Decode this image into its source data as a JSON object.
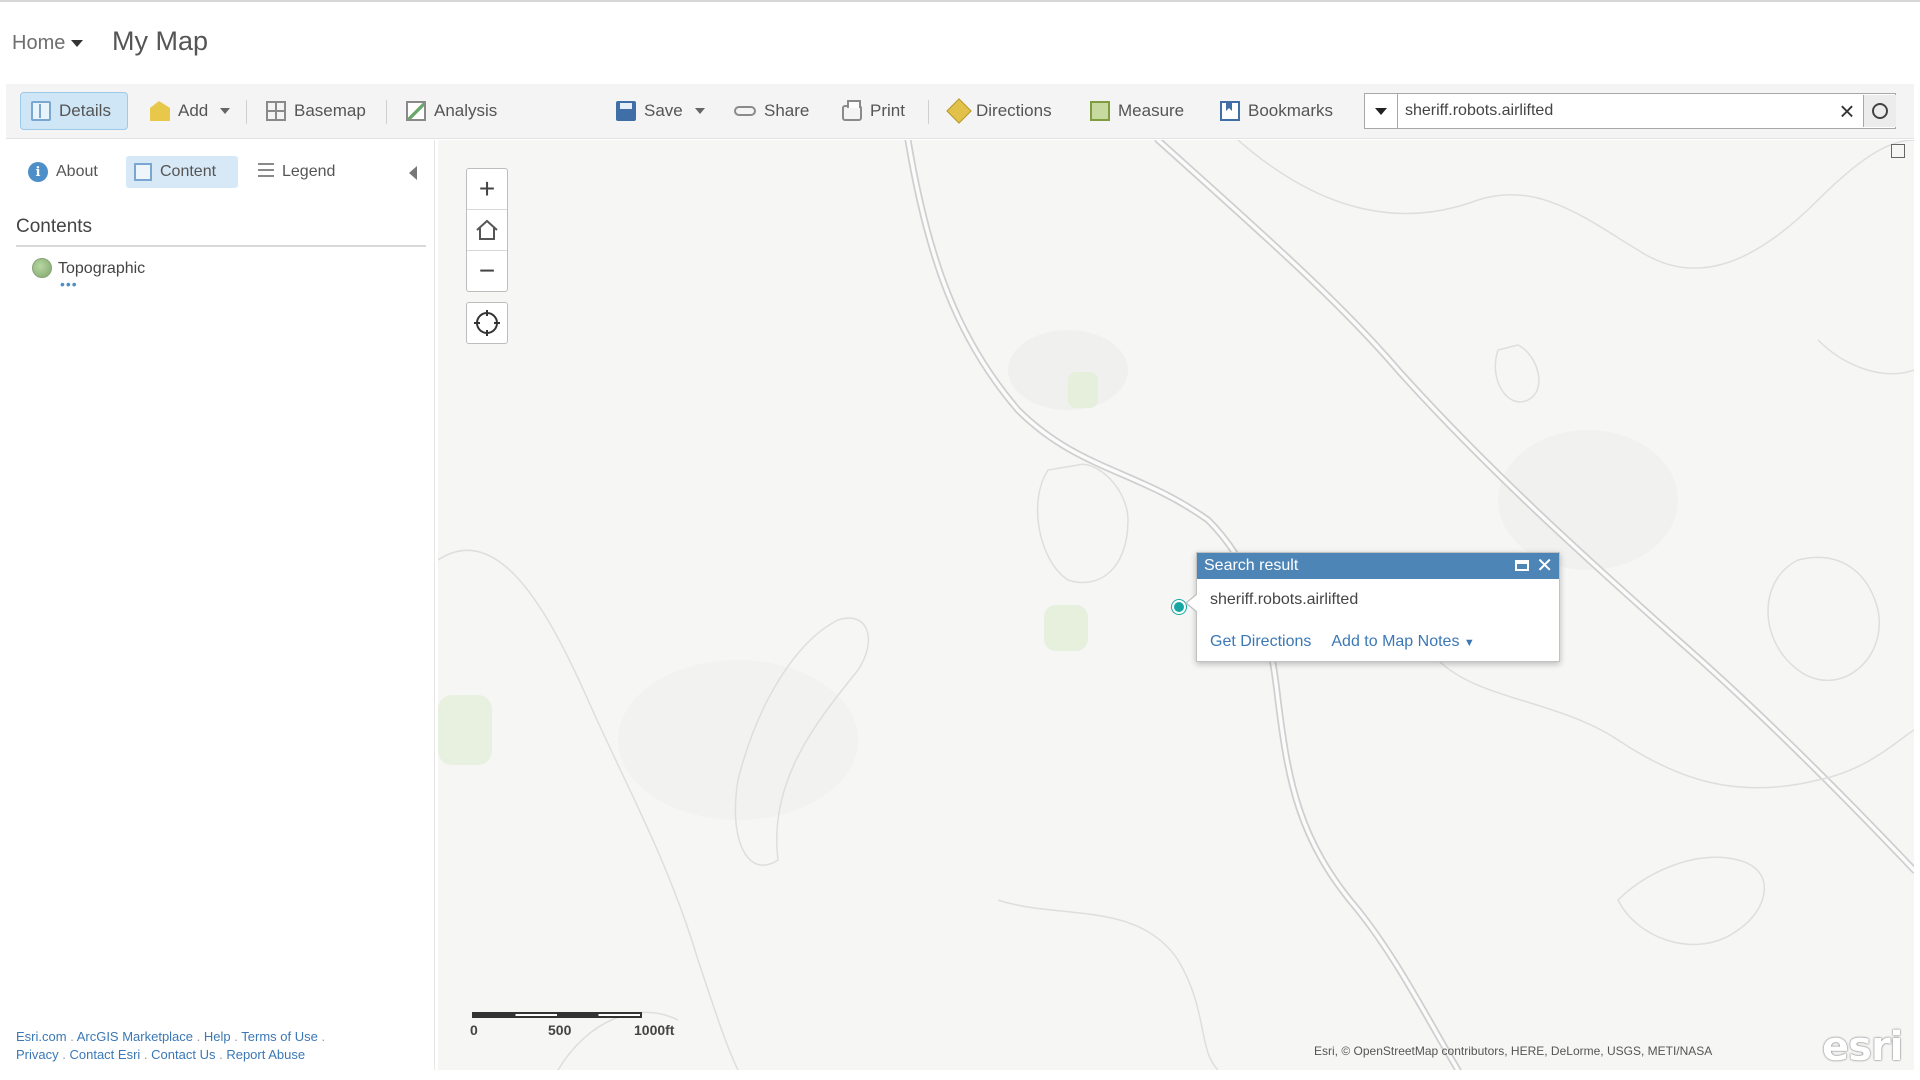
{
  "header": {
    "home_label": "Home",
    "map_title": "My Map"
  },
  "toolbar": {
    "details": "Details",
    "add": "Add",
    "basemap": "Basemap",
    "analysis": "Analysis",
    "save": "Save",
    "share": "Share",
    "print": "Print",
    "directions": "Directions",
    "measure": "Measure",
    "bookmarks": "Bookmarks"
  },
  "search": {
    "value": "sheriff.robots.airlifted"
  },
  "panel": {
    "tabs": {
      "about": "About",
      "content": "Content",
      "legend": "Legend"
    },
    "contents_title": "Contents",
    "layers": [
      {
        "name": "Topographic",
        "more": "•••"
      }
    ],
    "footer_links": [
      "Esri.com",
      "ArcGIS Marketplace",
      "Help",
      "Terms of Use",
      "Privacy",
      "Contact Esri",
      "Contact Us",
      "Report Abuse"
    ]
  },
  "map": {
    "zoom_in": "+",
    "zoom_out": "−",
    "popup": {
      "title": "Search result",
      "content": "sheriff.robots.airlifted",
      "get_directions": "Get Directions",
      "add_to_notes": "Add to Map Notes"
    },
    "scale": {
      "labels": [
        "0",
        "500",
        "1000ft"
      ]
    },
    "attribution": "Esri, © OpenStreetMap contributors, HERE, DeLorme, USGS, METI/NASA",
    "logo": "esri"
  },
  "colors": {
    "accent": "#4e85b7",
    "link": "#3b78b5",
    "marker": "#16a7a2",
    "active_tab": "#cfe6f7"
  }
}
